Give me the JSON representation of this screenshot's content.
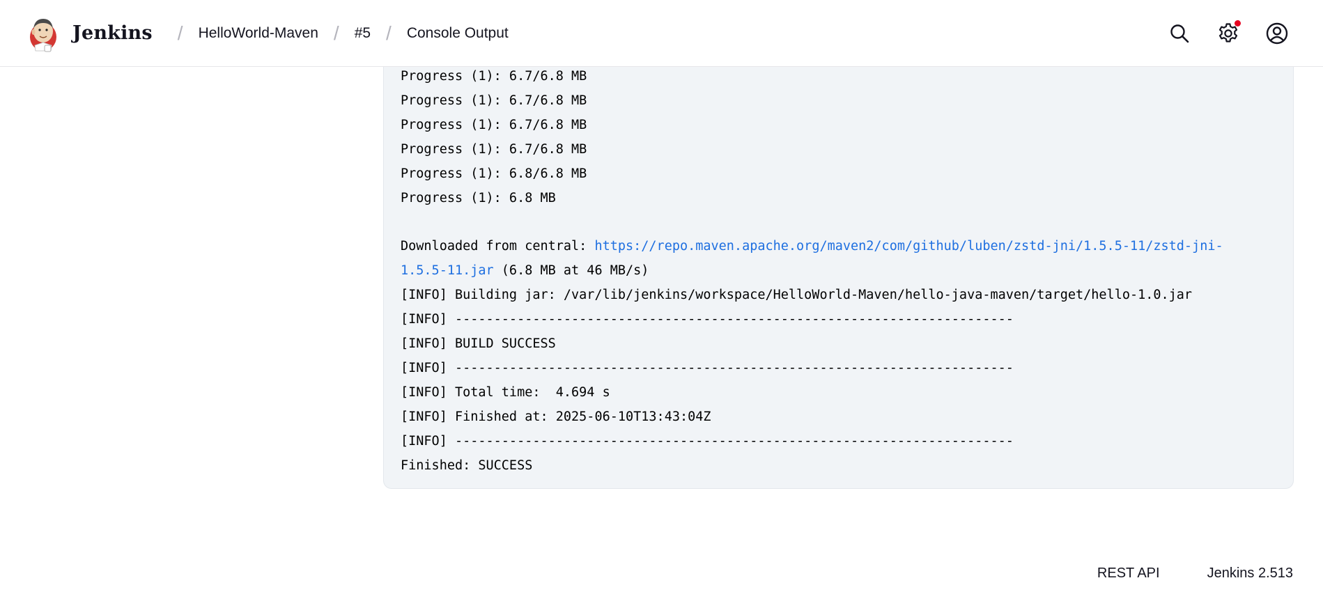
{
  "header": {
    "brand": "Jenkins",
    "breadcrumbs": [
      "HelloWorld-Maven",
      "#5",
      "Console Output"
    ],
    "icons": {
      "logo": "jenkins-butler-logo",
      "search": "search-icon",
      "settings": "gear-icon",
      "user": "user-circle-icon"
    },
    "notification_color": "#e6001f"
  },
  "console": {
    "progress_lines": [
      "Progress (1): 6.7/6.8 MB",
      "Progress (1): 6.7/6.8 MB",
      "Progress (1): 6.7/6.8 MB",
      "Progress (1): 6.7/6.8 MB",
      "Progress (1): 6.8/6.8 MB",
      "Progress (1): 6.8 MB"
    ],
    "download_prefix": "Downloaded from central: ",
    "download_url_part1": "https://repo.maven.apache.org/maven2/com/github/luben/zstd-jni/1.5.5-11/zstd-jni-",
    "download_url_part2": "1.5.5-11.jar",
    "download_suffix": " (6.8 MB at 46 MB/s)",
    "link_color": "#1e6fe0",
    "result_lines": [
      "[INFO] Building jar: /var/lib/jenkins/workspace/HelloWorld-Maven/hello-java-maven/target/hello-1.0.jar",
      "[INFO] ------------------------------------------------------------------------",
      "[INFO] BUILD SUCCESS",
      "[INFO] ------------------------------------------------------------------------",
      "[INFO] Total time:  4.694 s",
      "[INFO] Finished at: 2025-06-10T13:43:04Z",
      "[INFO] ------------------------------------------------------------------------",
      "Finished: SUCCESS"
    ]
  },
  "footer": {
    "rest_api": "REST API",
    "version": "Jenkins 2.513"
  }
}
